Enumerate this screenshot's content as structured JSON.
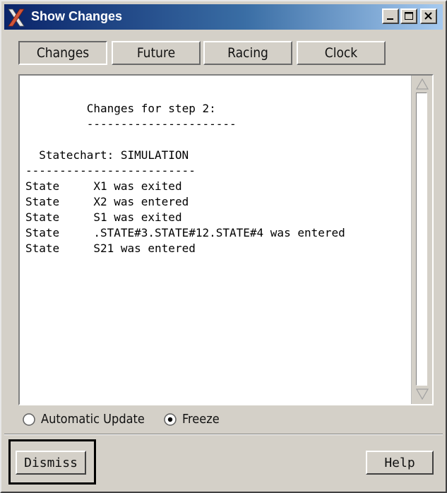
{
  "window": {
    "title": "Show Changes",
    "controls": {
      "minimize": "minimize",
      "maximize": "maximize",
      "close": "close"
    }
  },
  "tabs": [
    {
      "label": "Changes",
      "active": true
    },
    {
      "label": "Future",
      "active": false
    },
    {
      "label": "Racing",
      "active": false
    },
    {
      "label": "Clock",
      "active": false
    }
  ],
  "content": {
    "heading": "Changes for step 2:",
    "heading_rule": "----------------------",
    "statechart_line": "Statechart: SIMULATION",
    "statechart_rule": "-------------------------",
    "rows": [
      {
        "kind": "State",
        "text": "X1 was exited"
      },
      {
        "kind": "State",
        "text": "X2 was entered"
      },
      {
        "kind": "State",
        "text": "S1 was exited"
      },
      {
        "kind": "State",
        "text": ".STATE#3.STATE#12.STATE#4 was entered"
      },
      {
        "kind": "State",
        "text": "S21 was entered"
      }
    ]
  },
  "options": {
    "automatic_update_label": "Automatic Update",
    "freeze_label": "Freeze",
    "selected": "Freeze"
  },
  "buttons": {
    "dismiss": "Dismiss",
    "help": "Help"
  }
}
